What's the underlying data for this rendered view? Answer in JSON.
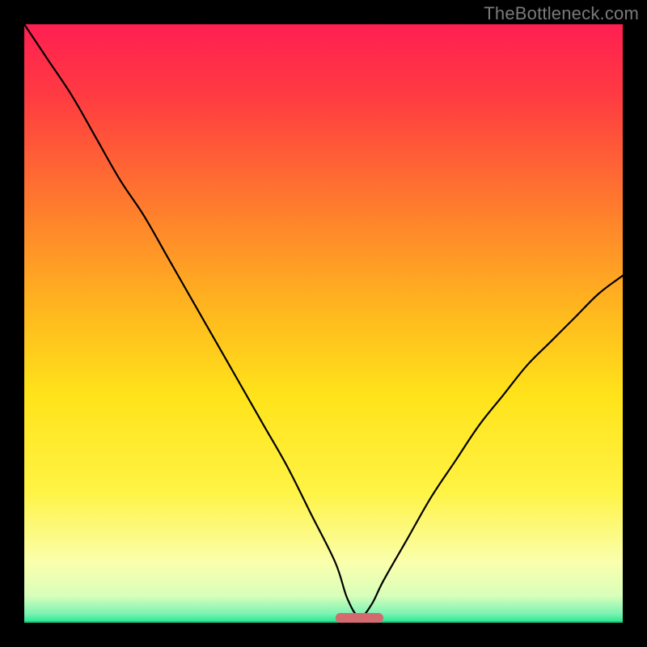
{
  "watermark": "TheBottleneck.com",
  "colors": {
    "frame": "#000000",
    "gradient_stops": [
      {
        "offset": 0.0,
        "color": "#ff1f52"
      },
      {
        "offset": 0.12,
        "color": "#ff3b41"
      },
      {
        "offset": 0.3,
        "color": "#ff7a2e"
      },
      {
        "offset": 0.48,
        "color": "#ffb81e"
      },
      {
        "offset": 0.62,
        "color": "#ffe31a"
      },
      {
        "offset": 0.78,
        "color": "#fff344"
      },
      {
        "offset": 0.9,
        "color": "#faffad"
      },
      {
        "offset": 0.955,
        "color": "#d8ffba"
      },
      {
        "offset": 0.985,
        "color": "#7cf2b2"
      },
      {
        "offset": 1.0,
        "color": "#1de98b"
      }
    ],
    "curve": "#000000",
    "trough_marker": "#d26a6f",
    "baseline": "#26c281"
  },
  "chart_data": {
    "type": "line",
    "title": "",
    "xlabel": "",
    "ylabel": "",
    "xlim": [
      0,
      100
    ],
    "ylim": [
      0,
      100
    ],
    "legend": false,
    "grid": false,
    "trough_x": 56,
    "trough_width": 8,
    "series": [
      {
        "name": "bottleneck-curve",
        "x": [
          0,
          4,
          8,
          12,
          16,
          20,
          24,
          28,
          32,
          36,
          40,
          44,
          48,
          52,
          54,
          56,
          58,
          60,
          64,
          68,
          72,
          76,
          80,
          84,
          88,
          92,
          96,
          100
        ],
        "y": [
          100,
          94,
          88,
          81,
          74,
          68,
          61,
          54,
          47,
          40,
          33,
          26,
          18,
          10,
          4,
          1,
          3,
          7,
          14,
          21,
          27,
          33,
          38,
          43,
          47,
          51,
          55,
          58
        ]
      }
    ]
  }
}
